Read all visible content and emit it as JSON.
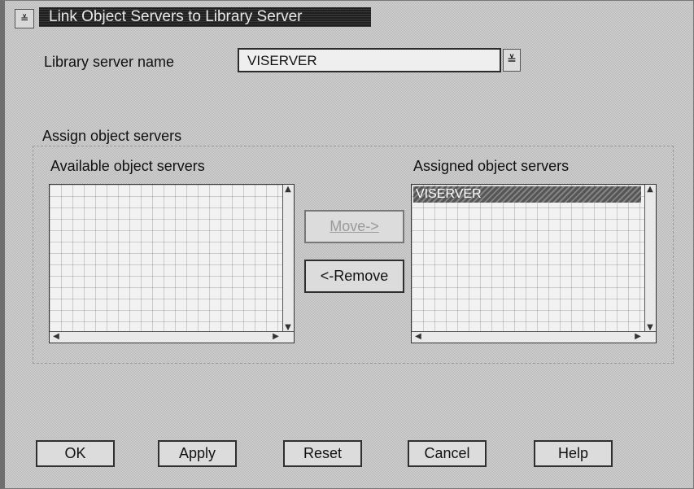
{
  "window": {
    "title": "Link Object Servers to Library Server",
    "sys_menu_icon": "≚"
  },
  "library_server": {
    "label": "Library server name",
    "value": "VISERVER",
    "dropdown_icon": "≚"
  },
  "group": {
    "title": "Assign object servers",
    "available_label": "Available object servers",
    "assigned_label": "Assigned object servers",
    "available_items": [],
    "assigned_items": [
      "VISERVER"
    ]
  },
  "actions": {
    "move": "Move->",
    "remove": "<-Remove"
  },
  "footer_buttons": {
    "ok": "OK",
    "apply": "Apply",
    "reset": "Reset",
    "cancel": "Cancel",
    "help": "Help"
  },
  "scroll_icons": {
    "up": "▲",
    "down": "▼",
    "left": "◀",
    "right": "▶"
  }
}
